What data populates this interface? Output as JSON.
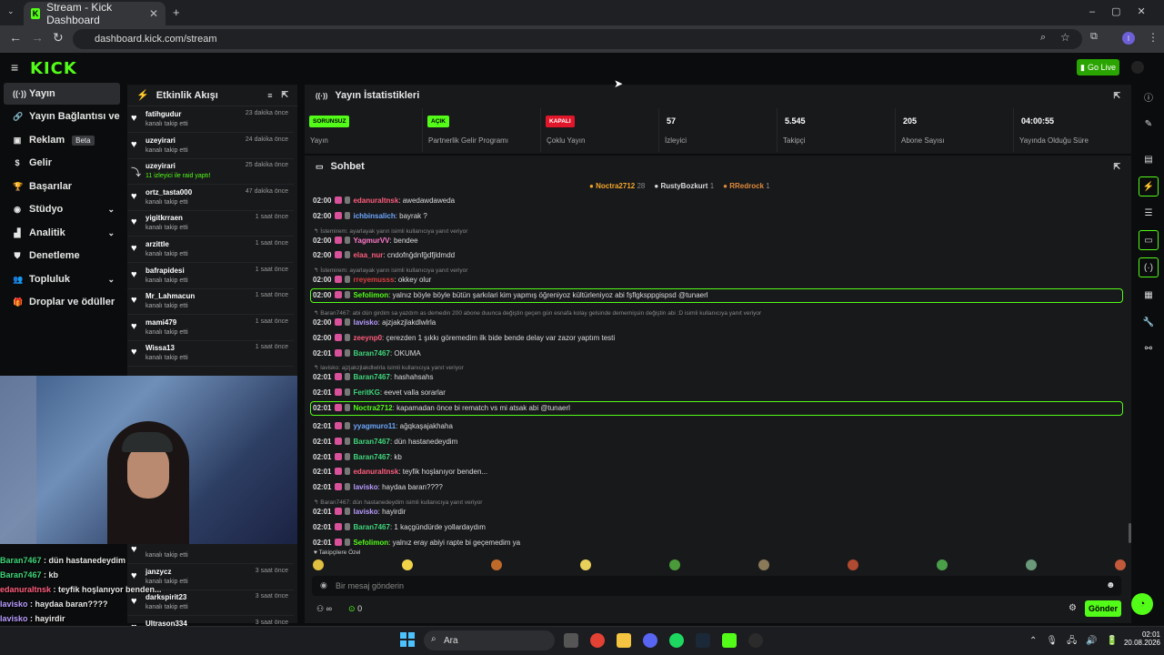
{
  "browser": {
    "tab_title": "Stream - Kick Dashboard",
    "url": "dashboard.kick.com/stream",
    "profile_initial": "I"
  },
  "brand": {
    "logo": "KICK",
    "accent": "#53fc18",
    "go_live": "Go Live"
  },
  "sidebar": {
    "items": [
      {
        "label": "Yayın",
        "icon": "broadcast-icon",
        "active": true
      },
      {
        "label": "Yayın Bağlantısı ve Anahtarı",
        "icon": "link-icon"
      },
      {
        "label": "Reklam",
        "icon": "ad-icon",
        "badge": "Beta"
      },
      {
        "label": "Gelir",
        "icon": "revenue-icon"
      },
      {
        "label": "Başarılar",
        "icon": "trophy-icon"
      },
      {
        "label": "Stüdyo",
        "icon": "studio-icon",
        "chevron": true
      },
      {
        "label": "Analitik",
        "icon": "chart-icon",
        "chevron": true
      },
      {
        "label": "Denetleme",
        "icon": "shield-icon"
      },
      {
        "label": "Topluluk",
        "icon": "users-icon",
        "chevron": true
      },
      {
        "label": "Droplar ve ödüller",
        "icon": "gift-icon"
      }
    ]
  },
  "activity": {
    "title": "Etkinlik Akışı",
    "events": [
      {
        "name": "fatihgudur",
        "desc": "kanalı takip etti",
        "time": "23 dakika önce"
      },
      {
        "name": "uzeyirari",
        "desc": "kanalı takip etti",
        "time": "24 dakika önce"
      },
      {
        "name": "uzeyirari",
        "desc": "11 izleyici ile raid yaptı!",
        "time": "25 dakika önce"
      },
      {
        "name": "ortz_tasta000",
        "desc": "kanalı takip etti",
        "time": "47 dakika önce"
      },
      {
        "name": "yigitkrraen",
        "desc": "kanalı takip etti",
        "time": "1 saat önce"
      },
      {
        "name": "arzittle",
        "desc": "kanalı takip etti",
        "time": "1 saat önce"
      },
      {
        "name": "bafrapidesi",
        "desc": "kanalı takip etti",
        "time": "1 saat önce"
      },
      {
        "name": "Mr_Lahmacun",
        "desc": "kanalı takip etti",
        "time": "1 saat önce"
      },
      {
        "name": "mami479",
        "desc": "kanalı takip etti",
        "time": "1 saat önce"
      },
      {
        "name": "Wissa13",
        "desc": "kanalı takip etti",
        "time": "1 saat önce"
      }
    ],
    "lower_events": [
      {
        "name": "",
        "desc": "kanalı takip etti",
        "time": ""
      },
      {
        "name": "janzycz",
        "desc": "kanalı takip etti",
        "time": "3 saat önce"
      },
      {
        "name": "darkspirit23",
        "desc": "kanalı takip etti",
        "time": "3 saat önce"
      },
      {
        "name": "Ultrason334",
        "desc": "",
        "time": "3 saat önce"
      }
    ]
  },
  "overlay_chat": [
    {
      "user": "Baran7467",
      "text": "dün hastanedeydim",
      "color": "#3fd67a"
    },
    {
      "user": "Baran7467",
      "text": "kb",
      "color": "#3fd67a"
    },
    {
      "user": "edanuraltnsk",
      "text": "teyfik hoşlanıyor benden...",
      "color": "#ff5d7d"
    },
    {
      "user": "lavisko",
      "text": "haydaa baran????",
      "color": "#b99cff"
    },
    {
      "user": "lavisko",
      "text": "hayirdir",
      "color": "#b99cff"
    },
    {
      "user": "Baran7467",
      "text": "1 kaçgündürde yollardaydım",
      "color": "#3fd67a"
    },
    {
      "user": "Sefolimon",
      "text": "yalnız eray abiyi rapte bi geçemedim ya",
      "color": "#53fc18"
    }
  ],
  "stats": {
    "title": "Yayın İstatistikleri",
    "cards": [
      {
        "badge": "SORUNSUZ",
        "label": "Yayın",
        "badge_color": "#53fc18"
      },
      {
        "badge": "AÇIK",
        "label": "Partnerlik Gelir Programı",
        "badge_color": "#53fc18"
      },
      {
        "badge": "KAPALI",
        "label": "Çoklu Yayın",
        "badge_color": "#e0162b"
      },
      {
        "value": "57",
        "label": "İzleyici"
      },
      {
        "value": "5.545",
        "label": "Takipçi"
      },
      {
        "value": "205",
        "label": "Abone Sayısı"
      },
      {
        "value": "04:00:55",
        "label": "Yayında Olduğu Süre"
      }
    ]
  },
  "chat": {
    "title": "Sohbet",
    "pinned": [
      {
        "name": "Noctra2712",
        "count": "28",
        "color": "#f4a72a"
      },
      {
        "name": "RustyBozkurt",
        "count": "1",
        "color": "#ddd"
      },
      {
        "name": "RRedrock",
        "count": "1",
        "color": "#e08b3a"
      }
    ],
    "messages": [
      {
        "type": "msg",
        "time": "02:00",
        "user": "edanuraltnsk",
        "color": "#ff5d7d",
        "text": "awedawdaweda"
      },
      {
        "type": "msg",
        "time": "02:00",
        "user": "ichbinsalich",
        "color": "#6da8ff",
        "text": "bayrak ?"
      },
      {
        "type": "reply",
        "text": "İstemirem: ayarlayak yarın isimli kullanıcıya yanıt veriyor"
      },
      {
        "type": "msg",
        "time": "02:00",
        "user": "YagmurVV",
        "color": "#ff7acb",
        "text": "bendee"
      },
      {
        "type": "msg",
        "time": "02:00",
        "user": "elaa_nur",
        "color": "#ff5d7d",
        "text": "cndofnğdnfğdfjldmdd"
      },
      {
        "type": "reply",
        "text": "İstemirem: ayarlayak yarın isimli kullanıcıya yanıt veriyor"
      },
      {
        "type": "msg",
        "time": "02:00",
        "user": "rreyemusss",
        "color": "#d84040",
        "text": "okkey olur"
      },
      {
        "type": "msg",
        "time": "02:00",
        "user": "Sefolimon",
        "color": "#53fc18",
        "text": "yalnız böyle böyle bütün şarkılari kim yapmış öğreniyoz kültürleniyoz abi fşflgksppgispsd @tunaerl",
        "hl": true
      },
      {
        "type": "reply",
        "text": "Baran7467: abi dün girdim sa yazdım as demedin 200 abone duunca değiştin geçen gün esnafa kolay gelsinde dememişsin değiştin abi :D isimli kullanıcıya yanıt veriyor"
      },
      {
        "type": "msg",
        "time": "02:00",
        "user": "lavisko",
        "color": "#b99cff",
        "text": "ajzjakzjlakdlwlrla"
      },
      {
        "type": "msg",
        "time": "02:00",
        "user": "zeeynp0",
        "color": "#ff5d7d",
        "text": "çerezden 1 şıkkı göremedim ilk bide bende delay var zazor yaptım testi"
      },
      {
        "type": "msg",
        "time": "02:01",
        "user": "Baran7467",
        "color": "#3fd67a",
        "text": "OKUMA"
      },
      {
        "type": "reply",
        "text": "lavisko: ajzjakzjlakdlwlrla isimli kullanıcıya yanıt veriyor"
      },
      {
        "type": "msg",
        "time": "02:01",
        "user": "Baran7467",
        "color": "#3fd67a",
        "text": "hashahsahs"
      },
      {
        "type": "msg",
        "time": "02:01",
        "user": "FeritKG",
        "color": "#3fd67a",
        "text": "eevet valla sorarlar"
      },
      {
        "type": "msg",
        "time": "02:01",
        "user": "Noctra2712",
        "color": "#53fc18",
        "text": "kapamadan önce bi rematch vs mi atsak abi @tunaerl",
        "hl": true
      },
      {
        "type": "msg",
        "time": "02:01",
        "user": "yyagmuro11",
        "color": "#6da8ff",
        "text": "ağqkaşajakhaha"
      },
      {
        "type": "msg",
        "time": "02:01",
        "user": "Baran7467",
        "color": "#3fd67a",
        "text": "dün hastanedeydim"
      },
      {
        "type": "msg",
        "time": "02:01",
        "user": "Baran7467",
        "color": "#3fd67a",
        "text": "kb"
      },
      {
        "type": "msg",
        "time": "02:01",
        "user": "edanuraltnsk",
        "color": "#ff5d7d",
        "text": "teyfik hoşlanıyor benden..."
      },
      {
        "type": "msg",
        "time": "02:01",
        "user": "lavisko",
        "color": "#b99cff",
        "text": "haydaa baran????"
      },
      {
        "type": "reply",
        "text": "Baran7467: dün hastanedeydim isimli kullanıcıya yanıt veriyor"
      },
      {
        "type": "msg",
        "time": "02:01",
        "user": "lavisko",
        "color": "#b99cff",
        "text": "hayirdir"
      },
      {
        "type": "msg",
        "time": "02:01",
        "user": "Baran7467",
        "color": "#3fd67a",
        "text": "1 kaçgündürde yollardaydım"
      },
      {
        "type": "msg",
        "time": "02:01",
        "user": "Sefolimon",
        "color": "#53fc18",
        "text": "yalnız eray abiyi rapte bi geçemedim ya"
      }
    ],
    "followers_only": "Takipçilere Özel",
    "input_placeholder": "Bir mesaj gönderin",
    "points": "0",
    "send": "Gönder"
  },
  "taskbar": {
    "search": "Ara",
    "time": "02:01",
    "date": "20.08.2026"
  }
}
